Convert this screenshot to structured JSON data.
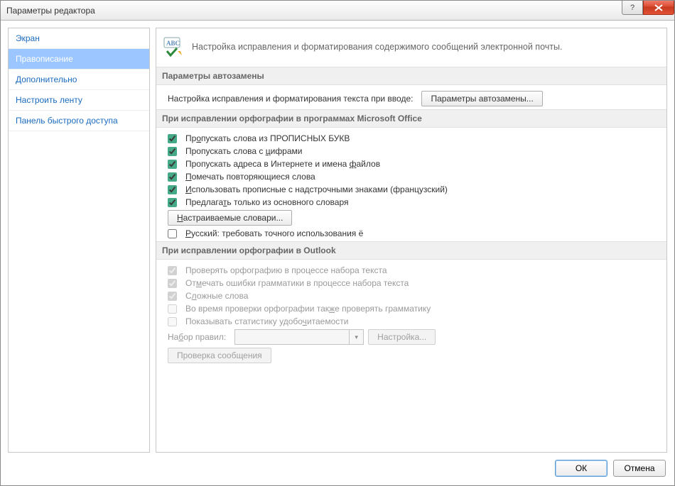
{
  "window": {
    "title": "Параметры редактора"
  },
  "sidebar": {
    "items": [
      {
        "label": "Экран"
      },
      {
        "label": "Правописание"
      },
      {
        "label": "Дополнительно"
      },
      {
        "label": "Настроить ленту"
      },
      {
        "label": "Панель быстрого доступа"
      }
    ],
    "selected_index": 1
  },
  "header": {
    "text": "Настройка исправления и форматирования содержимого сообщений электронной почты."
  },
  "sections": {
    "autocorrect": {
      "title": "Параметры автозамены",
      "row_label": "Настройка исправления и форматирования текста при вводе:",
      "button": "Параметры автозамены..."
    },
    "office_spell": {
      "title": "При исправлении орфографии в программах Microsoft Office",
      "checks": [
        {
          "label_pre": "Пр",
          "u": "о",
          "label_post": "пускать слова из ПРОПИСНЫХ БУКВ",
          "checked": true
        },
        {
          "label_pre": "Пропускать слова с ",
          "u": "ц",
          "label_post": "ифрами",
          "checked": true
        },
        {
          "label_pre": "Пропускать адреса в Интернете и имена ",
          "u": "ф",
          "label_post": "айлов",
          "checked": true
        },
        {
          "label_pre": "",
          "u": "П",
          "label_post": "омечать повторяющиеся слова",
          "checked": true
        },
        {
          "label_pre": "",
          "u": "И",
          "label_post": "спользовать прописные с надстрочными знаками (французский)",
          "checked": true
        },
        {
          "label_pre": "Предлага",
          "u": "т",
          "label_post": "ь только из основного словаря",
          "checked": true
        }
      ],
      "custom_dict_button_pre": "",
      "custom_dict_button_u": "Н",
      "custom_dict_button_post": "астраиваемые словари...",
      "yo_check": {
        "label_pre": "",
        "u": "Р",
        "label_post": "усский: требовать точного использования ё",
        "checked": false
      }
    },
    "outlook_spell": {
      "title": "При исправлении орфографии в Outlook",
      "checks": [
        {
          "label": "Проверять орфографию в процессе набора текста",
          "checked": true,
          "disabled": true
        },
        {
          "label_pre": "От",
          "u": "м",
          "label_post": "ечать ошибки грамматики в процессе набора текста",
          "checked": true,
          "disabled": true
        },
        {
          "label_pre": "С",
          "u": "л",
          "label_post": "ожные слова",
          "checked": true,
          "disabled": true
        },
        {
          "label_pre": "Во время проверки орфографии так",
          "u": "ж",
          "label_post": "е проверять грамматику",
          "checked": false,
          "disabled": true
        },
        {
          "label_pre": "Показывать статистику удобо",
          "u": "ч",
          "label_post": "итаемости",
          "checked": false,
          "disabled": true
        }
      ],
      "ruleset_label_pre": "На",
      "ruleset_label_u": "б",
      "ruleset_label_post": "ор правил:",
      "ruleset_value": "",
      "settings_button": "Настройка...",
      "recheck_button": "Проверка сообщения"
    }
  },
  "dialog_buttons": {
    "ok": "ОК",
    "cancel": "Отмена"
  }
}
